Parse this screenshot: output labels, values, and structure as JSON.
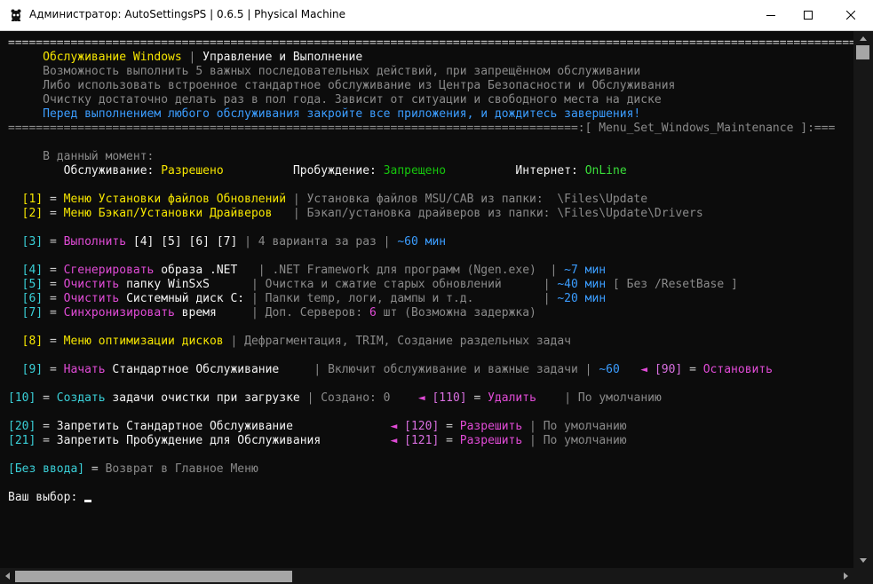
{
  "window": {
    "title": "Администратор: AutoSettingsPS | 0.6.5 | Physical Machine"
  },
  "icons": {
    "app": "app-mascot-icon",
    "minimize": "minimize-icon",
    "maximize": "maximize-icon",
    "close": "close-icon"
  },
  "colors": {
    "background": "#0c0c0c",
    "default": "#cccccc",
    "gray": "#8a8a8a",
    "white": "#f2f2f2",
    "yellow": "#f9f1a5",
    "gold": "#f6e600",
    "green": "#16c60c",
    "lime": "#3adf3a",
    "cyan": "#3ad0d8",
    "blue": "#3b9dff",
    "magenta": "#e04bd6",
    "pink": "#d96fe0"
  },
  "console": {
    "lines": [
      [
        [
          "=================================================================================================================================",
          "default"
        ]
      ],
      [
        [
          "     ",
          "default"
        ],
        [
          "Обслуживание Windows",
          "gold"
        ],
        [
          " | ",
          "gray"
        ],
        [
          "Управление и Выполнение",
          "white"
        ]
      ],
      [
        [
          "     ",
          "default"
        ],
        [
          "Возможность выполнить 5 важных последовательных действий, при запрещённом обслуживании",
          "gray"
        ]
      ],
      [
        [
          "     ",
          "default"
        ],
        [
          "Либо использовать встроенное стандартное обслуживание из Центра Безопасности и Обслуживания",
          "gray"
        ]
      ],
      [
        [
          "     ",
          "default"
        ],
        [
          "Очистку достаточно делать раз в пол года. Зависит от ситуации и свободного места на диске",
          "gray"
        ]
      ],
      [
        [
          "     ",
          "default"
        ],
        [
          "Перед выполнением любого обслуживания закройте все приложения, и дождитесь завершения!",
          "blue"
        ]
      ],
      [
        [
          "==================================================================================:[ Menu_Set_Windows_Maintenance ]:===",
          "gray"
        ]
      ],
      [],
      [
        [
          "     ",
          "default"
        ],
        [
          "В данный момент:",
          "gray"
        ]
      ],
      [
        [
          "        ",
          "default"
        ],
        [
          "Обслуживание: ",
          "white"
        ],
        [
          "Разрешено",
          "gold"
        ],
        [
          "          ",
          "default"
        ],
        [
          "Пробуждение: ",
          "white"
        ],
        [
          "Запрещено",
          "green"
        ],
        [
          "          ",
          "default"
        ],
        [
          "Интернет: ",
          "white"
        ],
        [
          "OnLine",
          "lime"
        ]
      ],
      [],
      [
        [
          "  ",
          "default"
        ],
        [
          "[1]",
          "gold"
        ],
        [
          " = ",
          "default"
        ],
        [
          "Меню Установки файлов Обновлений",
          "gold"
        ],
        [
          " | ",
          "gray"
        ],
        [
          "Установка файлов MSU/CAB из папки:  \\Files\\Update",
          "gray"
        ]
      ],
      [
        [
          "  ",
          "default"
        ],
        [
          "[2]",
          "gold"
        ],
        [
          " = ",
          "default"
        ],
        [
          "Меню Бэкап/Установки Драйверов",
          "gold"
        ],
        [
          "   | ",
          "gray"
        ],
        [
          "Бэкап/установка драйверов из папки: \\Files\\Update\\Drivers",
          "gray"
        ]
      ],
      [],
      [
        [
          "  ",
          "default"
        ],
        [
          "[3]",
          "cyan"
        ],
        [
          " = ",
          "default"
        ],
        [
          "Выполнить",
          "magenta"
        ],
        [
          " [4] [5] [6] [7]",
          "white"
        ],
        [
          " | ",
          "gray"
        ],
        [
          "4 варианта за раз",
          "gray"
        ],
        [
          " | ",
          "gray"
        ],
        [
          "~60 мин",
          "blue"
        ]
      ],
      [],
      [
        [
          "  ",
          "default"
        ],
        [
          "[4]",
          "cyan"
        ],
        [
          " = ",
          "default"
        ],
        [
          "Сгенерировать",
          "magenta"
        ],
        [
          " образа .NET",
          "white"
        ],
        [
          "   | ",
          "gray"
        ],
        [
          ".NET Framework для программ (Ngen.exe)",
          "gray"
        ],
        [
          "  | ",
          "gray"
        ],
        [
          "~7 мин",
          "blue"
        ]
      ],
      [
        [
          "  ",
          "default"
        ],
        [
          "[5]",
          "cyan"
        ],
        [
          " = ",
          "default"
        ],
        [
          "Очистить",
          "magenta"
        ],
        [
          " папку WinSxS",
          "white"
        ],
        [
          "      | ",
          "gray"
        ],
        [
          "Очистка и сжатие старых обновлений",
          "gray"
        ],
        [
          "      | ",
          "gray"
        ],
        [
          "~40 мин",
          "blue"
        ],
        [
          " [ Без /ResetBase ]",
          "gray"
        ]
      ],
      [
        [
          "  ",
          "default"
        ],
        [
          "[6]",
          "cyan"
        ],
        [
          " = ",
          "default"
        ],
        [
          "Очистить",
          "magenta"
        ],
        [
          " Системный диск C:",
          "white"
        ],
        [
          " | ",
          "gray"
        ],
        [
          "Папки temp, логи, дампы и т.д.",
          "gray"
        ],
        [
          "          | ",
          "gray"
        ],
        [
          "~20 мин",
          "blue"
        ]
      ],
      [
        [
          "  ",
          "default"
        ],
        [
          "[7]",
          "cyan"
        ],
        [
          " = ",
          "default"
        ],
        [
          "Синхронизировать",
          "magenta"
        ],
        [
          " время",
          "white"
        ],
        [
          "     | ",
          "gray"
        ],
        [
          "Доп. Серверов: ",
          "gray"
        ],
        [
          "6",
          "magenta"
        ],
        [
          " шт (Возможна задержка)",
          "gray"
        ]
      ],
      [],
      [
        [
          "  ",
          "default"
        ],
        [
          "[8]",
          "gold"
        ],
        [
          " = ",
          "default"
        ],
        [
          "Меню оптимизации дисков",
          "gold"
        ],
        [
          " | ",
          "gray"
        ],
        [
          "Дефрагментация, TRIM, Создание раздельных задач",
          "gray"
        ]
      ],
      [],
      [
        [
          "  ",
          "default"
        ],
        [
          "[9]",
          "cyan"
        ],
        [
          " = ",
          "default"
        ],
        [
          "Начать",
          "magenta"
        ],
        [
          " Стандартное Обслуживание",
          "white"
        ],
        [
          "     | ",
          "gray"
        ],
        [
          "Включит обслуживание и важные задачи",
          "gray"
        ],
        [
          " | ",
          "gray"
        ],
        [
          "~60",
          "blue"
        ],
        [
          "   ◄ ",
          "magenta"
        ],
        [
          "[90]",
          "pink"
        ],
        [
          " = ",
          "default"
        ],
        [
          "Остановить",
          "magenta"
        ]
      ],
      [],
      [
        [
          "",
          "default"
        ],
        [
          "[10]",
          "cyan"
        ],
        [
          " = ",
          "default"
        ],
        [
          "Создать",
          "cyan"
        ],
        [
          " задачи очистки при загрузке",
          "white"
        ],
        [
          " | ",
          "gray"
        ],
        [
          "Создано: 0",
          "gray"
        ],
        [
          "    ◄ ",
          "magenta"
        ],
        [
          "[110]",
          "pink"
        ],
        [
          " = ",
          "default"
        ],
        [
          "Удалить",
          "magenta"
        ],
        [
          "    | ",
          "gray"
        ],
        [
          "По умолчанию",
          "gray"
        ]
      ],
      [],
      [
        [
          "",
          "default"
        ],
        [
          "[20]",
          "cyan"
        ],
        [
          " = ",
          "default"
        ],
        [
          "Запретить Стандартное Обслуживание",
          "white"
        ],
        [
          "              ◄ ",
          "magenta"
        ],
        [
          "[120]",
          "pink"
        ],
        [
          " = ",
          "default"
        ],
        [
          "Разрешить",
          "magenta"
        ],
        [
          " | ",
          "gray"
        ],
        [
          "По умолчанию",
          "gray"
        ]
      ],
      [
        [
          "",
          "default"
        ],
        [
          "[21]",
          "cyan"
        ],
        [
          " = ",
          "default"
        ],
        [
          "Запретить Пробуждение для Обслуживания",
          "white"
        ],
        [
          "          ◄ ",
          "magenta"
        ],
        [
          "[121]",
          "pink"
        ],
        [
          " = ",
          "default"
        ],
        [
          "Разрешить",
          "magenta"
        ],
        [
          " | ",
          "gray"
        ],
        [
          "По умолчанию",
          "gray"
        ]
      ],
      [],
      [
        [
          "",
          "default"
        ],
        [
          "[Без ввода]",
          "cyan"
        ],
        [
          " = ",
          "default"
        ],
        [
          "Возврат в Главное Меню",
          "gray"
        ]
      ],
      [],
      [
        [
          "",
          "default"
        ],
        [
          "Ваш выбор: ",
          "white"
        ]
      ]
    ]
  }
}
